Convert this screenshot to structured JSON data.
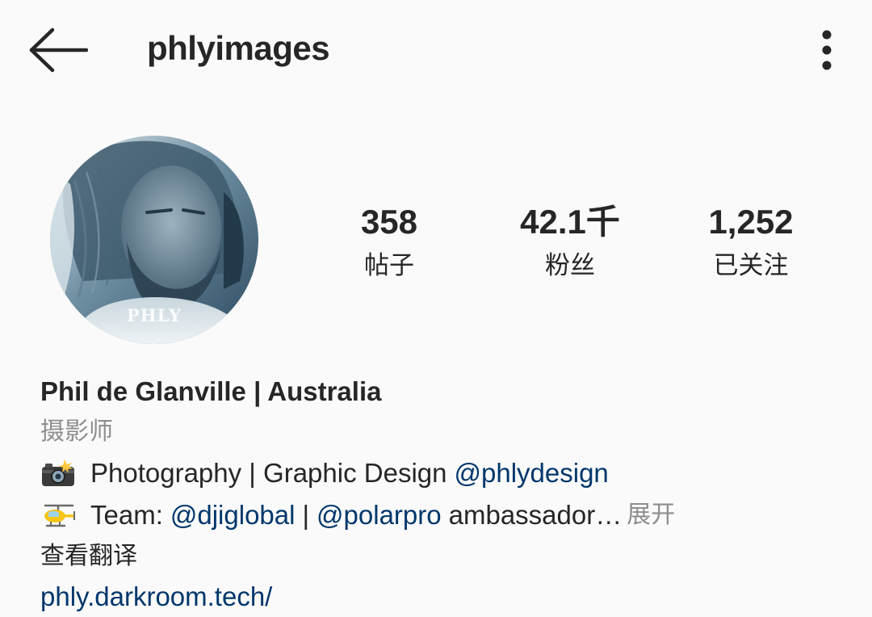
{
  "header": {
    "username": "phlyimages",
    "back_icon": "arrow-left-icon",
    "more_icon": "more-vertical-icon"
  },
  "profile": {
    "avatar_watermark": "PHLY",
    "stats": [
      {
        "value": "358",
        "label": "帖子"
      },
      {
        "value": "42.1千",
        "label": "粉丝"
      },
      {
        "value": "1,252",
        "label": "已关注"
      }
    ],
    "display_name": "Phil de Glanville | Australia",
    "category": "摄影师",
    "bio": {
      "line1": {
        "emoji": "camera-with-flash-icon",
        "text": "Photography | Graphic Design",
        "mention": "@phlydesign"
      },
      "line2": {
        "emoji": "helicopter-icon",
        "prefix": "Team:",
        "mention1": "@djiglobal",
        "separator": "|",
        "mention2": "@polarpro",
        "suffix": "ambassador…",
        "more": "展开"
      }
    },
    "translate": "查看翻译",
    "website": "phly.darkroom.tech/"
  },
  "colors": {
    "background": "#fafafa",
    "text": "#262626",
    "secondary": "#8e8e8e",
    "link": "#00376b"
  }
}
